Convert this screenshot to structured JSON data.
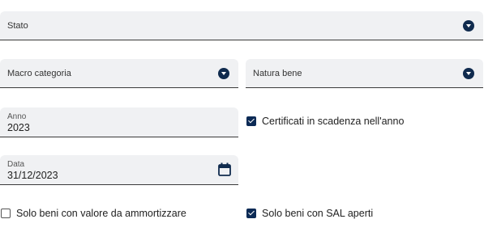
{
  "stato": {
    "label": "Stato",
    "icon": "dropdown-icon"
  },
  "macro_categoria": {
    "label": "Macro categoria",
    "icon": "dropdown-icon"
  },
  "natura_bene": {
    "label": "Natura bene",
    "icon": "dropdown-icon"
  },
  "anno": {
    "label": "Anno",
    "value": "2023"
  },
  "data": {
    "label": "Data",
    "value": "31/12/2023",
    "icon": "calendar-icon"
  },
  "certificati": {
    "label": "Certificati in scadenza nell'anno",
    "checked": true
  },
  "solo_beni_ammortizzare": {
    "label": "Solo beni con valore da ammortizzare",
    "checked": false
  },
  "solo_beni_sal": {
    "label": "Solo beni con SAL aperti",
    "checked": true
  },
  "colors": {
    "accent": "#102b4e",
    "field_bg": "#f0f1f3",
    "underline": "#3a3a3a"
  }
}
